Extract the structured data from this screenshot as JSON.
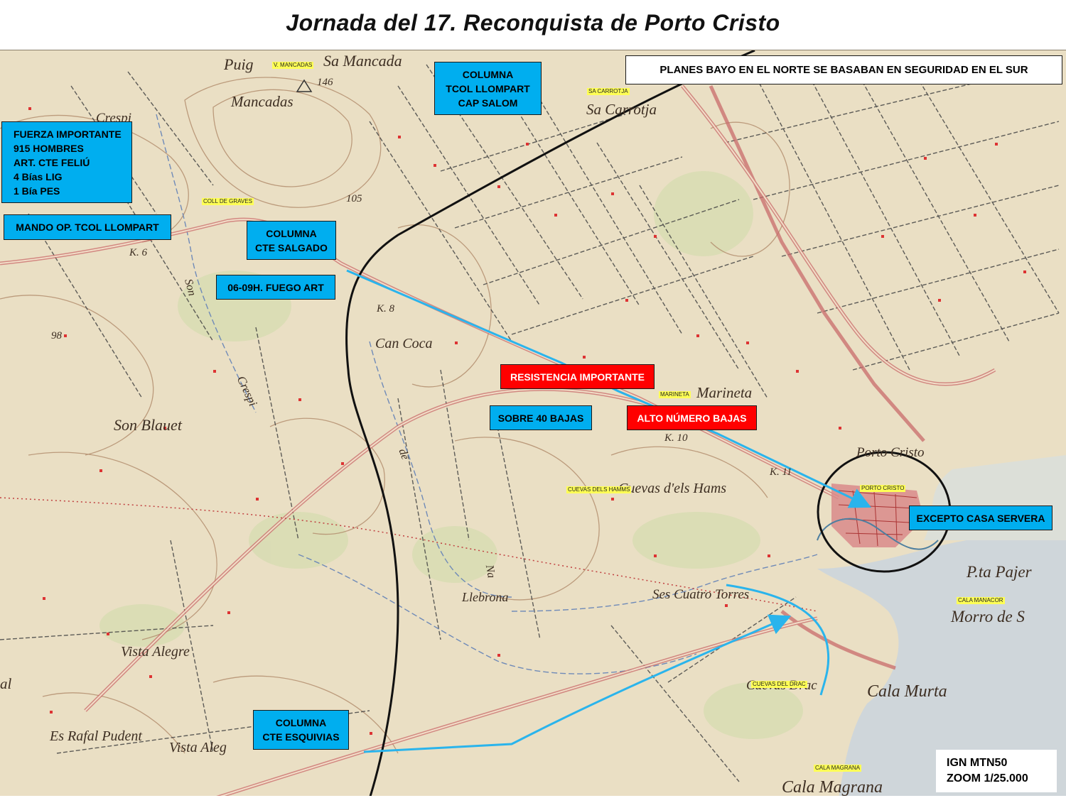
{
  "title": "Jornada del 17. Reconquista de Porto Cristo",
  "header_note": "PLANES BAYO EN EL NORTE SE BASABAN EN SEGURIDAD EN EL SUR",
  "boxes": {
    "fuerza": [
      "FUERZA IMPORTANTE",
      "915 HOMBRES",
      "ART. CTE FELIÚ",
      "4 Bías LIG",
      "1 Bía PES"
    ],
    "mando": "MANDO OP. TCOL LLOMPART",
    "col_llompart": [
      "COLUMNA",
      "TCOL  LLOMPART",
      "CAP SALOM"
    ],
    "col_salgado": [
      "COLUMNA",
      "CTE SALGADO"
    ],
    "fuego_art": "06-09H. FUEGO ART",
    "resistencia": "RESISTENCIA IMPORTANTE",
    "sobre40": "SOBRE 40 BAJAS",
    "alto_numero": "ALTO NÚMERO BAJAS",
    "excepto": "EXCEPTO CASA SERVERA",
    "col_esquivias": [
      "COLUMNA",
      "CTE ESQUIVIAS"
    ]
  },
  "source_note": [
    "IGN MTN50",
    "ZOOM 1/25.000"
  ],
  "tags": {
    "mancadas": "V. MANCADAS",
    "sa_carrotja": "SA CARROTJA",
    "coll_graves": "COLL DE GRAVES",
    "marineta": "MARINETA",
    "cuevas_hams": "CUEVAS DELS HAMMS",
    "porto_cristo": "PORTO CRISTO",
    "cala_manacor": "CALA MANACOR",
    "cuevas_drac": "CUEVAS DEL DRAC",
    "cala_magrana": "CALA MAGRANA"
  },
  "map_labels": {
    "puig": "Puig",
    "sa_mancada": "Sa Mancada",
    "mancadas": "Mancadas",
    "h146": "146",
    "crespi": "Crespi",
    "h105": "105",
    "sa_carrotja": "Sa Carrotja",
    "k6": "K. 6",
    "k8": "K. 8",
    "k10": "K. 10",
    "k11": "K. 11",
    "h98": "98",
    "can_coca": "Can Coca",
    "son_blauet": "Son Blauet",
    "marineta": "Marineta",
    "porto_cristo": "Porto Cristo",
    "cuevas_hams": "Cuevas d'els Hams",
    "pta_pajer": "P.ta Pajer",
    "morro": "Morro de S",
    "ses_cuatro_torres": "Ses Cuatro Torres",
    "llebrona": "Llebrona",
    "vista_alegre": "Vista Alegre",
    "vista_alegre2": "Vista Aleg",
    "es_rafal": "Es Rafal Pudent",
    "cuevas_drac": "Cuevas  Drac",
    "cala_murta": "Cala Murta",
    "cala_magrana": "Cala Magrana",
    "crespi2": "Crespi",
    "na": "Na",
    "de": "de",
    "son": "Son",
    "al": "al"
  },
  "colors": {
    "arrow": "#2ab4ec",
    "front_line": "#111111",
    "map_bg": "#eadfc4",
    "road": "#c96b6b",
    "relief": "#b08a6a"
  }
}
